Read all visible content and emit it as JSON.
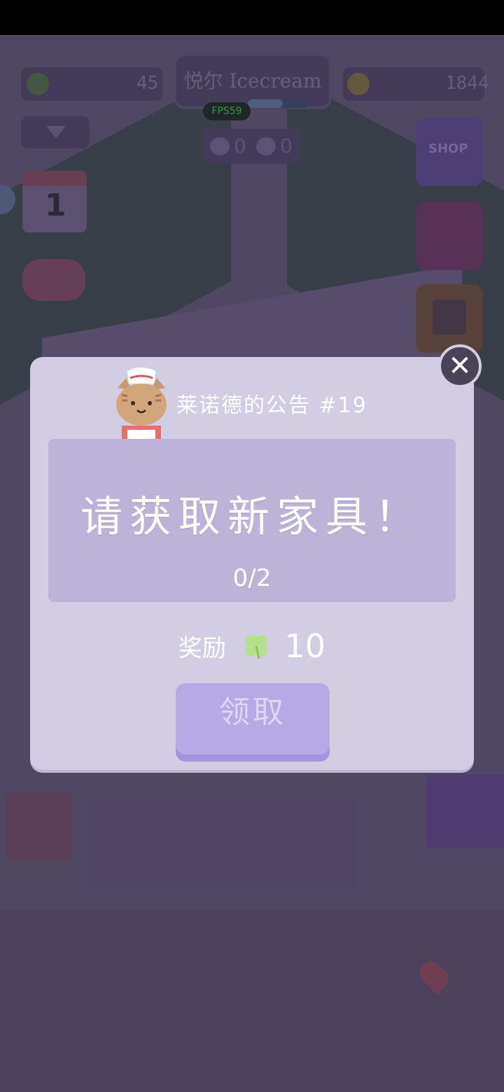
{
  "hud": {
    "clover_count": "45",
    "shop_name": "悦尔 Icecream",
    "fps": "FPS59",
    "coin_count": "1844",
    "dogs": "0",
    "cats": "0",
    "shop_button_label": "SHOP",
    "calendar_day": "1"
  },
  "dialog": {
    "title": "莱诺德的公告 #19",
    "task": "请获取新家具！",
    "progress": "0/2",
    "reward_label": "奖励",
    "reward_value": "10",
    "claim_label": "领取"
  },
  "colors": {
    "dialog_bg": "#d3cde3",
    "panel_bg": "#bdb3d8",
    "claim_bg": "#b7a8e6",
    "fps_text": "#38c23e"
  }
}
